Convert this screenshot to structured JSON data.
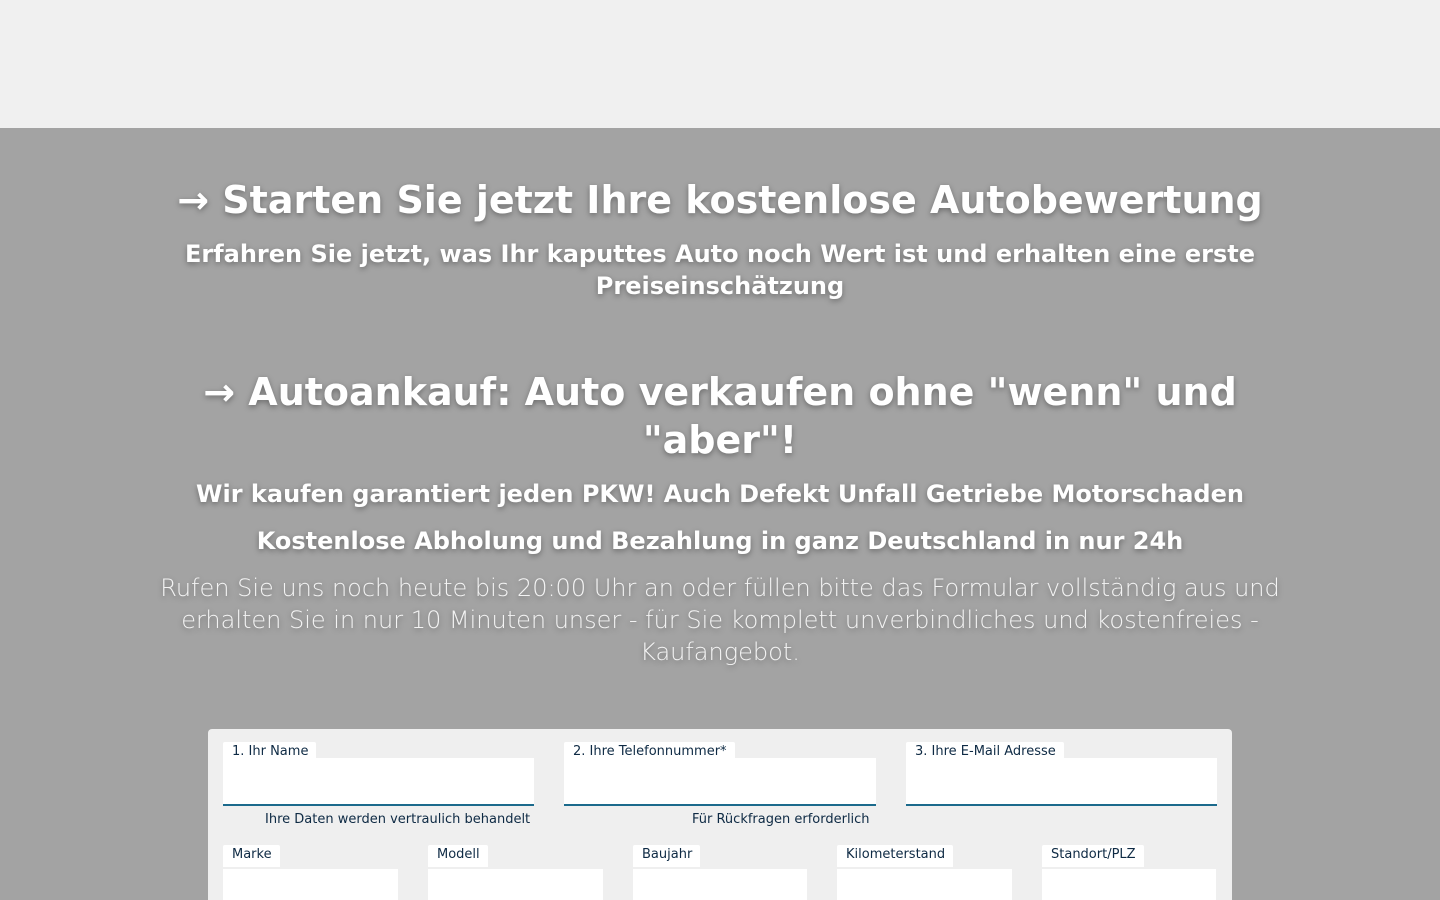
{
  "hero": {
    "title1": "→ Starten Sie jetzt Ihre kostenlose Autobewertung",
    "subtitle1": "Erfahren Sie jetzt, was Ihr kaputtes Auto noch Wert ist und erhalten eine erste Preiseinschätzung",
    "title2": "→ Autoankauf: Auto verkaufen ohne \"wenn\" und \"aber\"!",
    "subtitle2": "Wir kaufen garantiert jeden PKW! Auch Defekt Unfall Getriebe Motorschaden",
    "subtitle3": "Kostenlose Abholung und Bezahlung in ganz Deutschland in nur 24h",
    "lead": "Rufen Sie uns noch heute bis 20:00 Uhr an oder füllen bitte das Formular vollständig aus und erhalten Sie in nur 10 Minuten unser - für Sie komplett unverbindliches und kostenfreies - Kaufangebot."
  },
  "form": {
    "name": {
      "label": "1. Ihr Name",
      "value": "",
      "hint": "Ihre Daten werden vertraulich behandelt"
    },
    "phone": {
      "label": "2. Ihre Telefonnummer*",
      "value": "",
      "hint": "Für Rückfragen erforderlich"
    },
    "email": {
      "label": "3. Ihre E-Mail Adresse",
      "value": ""
    },
    "make": {
      "label": "Marke",
      "value": ""
    },
    "model": {
      "label": "Modell",
      "value": ""
    },
    "year": {
      "label": "Baujahr",
      "value": ""
    },
    "mileage": {
      "label": "Kilometerstand",
      "value": ""
    },
    "location": {
      "label": "Standort/PLZ",
      "value": ""
    }
  },
  "colors": {
    "topbar": "#f0f0f0",
    "hero_bg": "#a3a3a3",
    "form_bg": "#efefef",
    "label_text": "#0e2a44",
    "input_underline": "#1b6a8c"
  }
}
